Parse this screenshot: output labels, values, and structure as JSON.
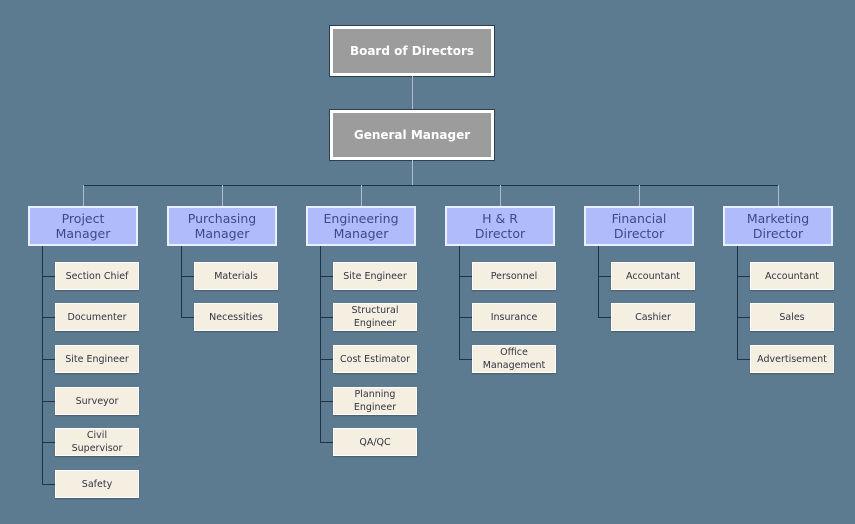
{
  "top": {
    "board": "Board of Directors",
    "general_manager": "General Manager"
  },
  "departments": [
    {
      "title": "Project Manager",
      "children": [
        "Section Chief",
        "Documenter",
        "Site Engineer",
        "Surveyor",
        "Civil Supervisor",
        "Safety"
      ]
    },
    {
      "title": "Purchasing Manager",
      "children": [
        "Materials",
        "Necessities"
      ]
    },
    {
      "title": "Engineering Manager",
      "children": [
        "Site Engineer",
        "Structural Engineer",
        "Cost Estimator",
        "Planning Engineer",
        "QA/QC"
      ]
    },
    {
      "title": "H & R Director",
      "children": [
        "Personnel",
        "Insurance",
        "Office Management"
      ]
    },
    {
      "title": "Financial Director",
      "children": [
        "Accountant",
        "Cashier"
      ]
    },
    {
      "title": "Marketing Director",
      "children": [
        "Accountant",
        "Sales",
        "Advertisement"
      ]
    }
  ],
  "colors": {
    "background": "#5d7b90",
    "top_box": "#9c9c9c",
    "manager_box": "#b0bbfb",
    "child_box": "#f4efe0"
  }
}
